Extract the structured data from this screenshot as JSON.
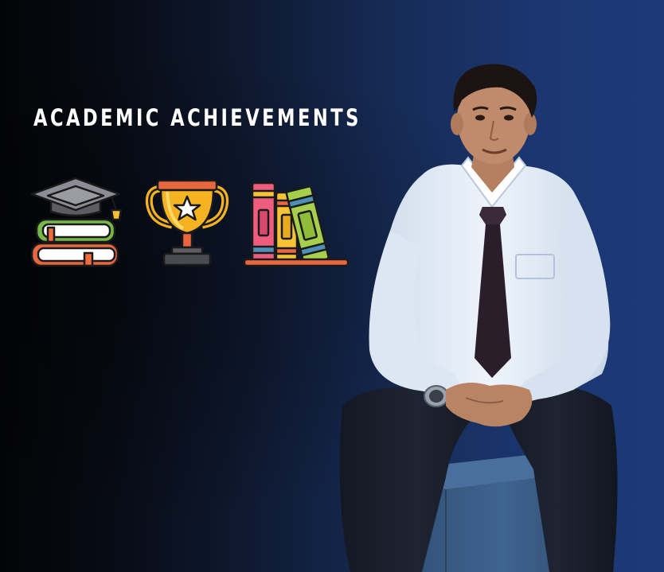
{
  "heading": "ACADEMIC ACHIEVEMENTS",
  "icons": [
    {
      "name": "graduation-books-icon"
    },
    {
      "name": "trophy-icon"
    },
    {
      "name": "bookshelf-icon"
    }
  ],
  "colors": {
    "background_left": "#030406",
    "background_right": "#1d3a78",
    "heading_text": "#ffffff",
    "trophy_gold": "#f5b321",
    "book_pink": "#ee5d7e",
    "book_yellow": "#f7c234",
    "book_green": "#a6cf4c",
    "shirt": "#dfe9f5",
    "tie": "#2a1e2a",
    "seat": "#3c608c"
  }
}
